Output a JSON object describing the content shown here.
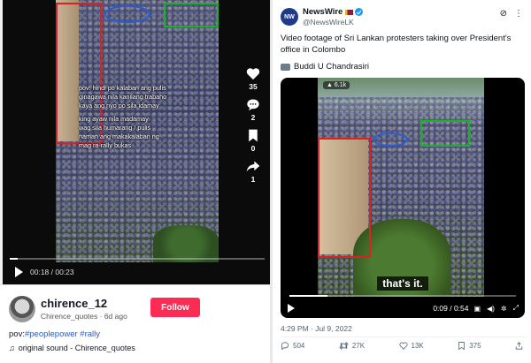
{
  "tiktok": {
    "caption_lines": [
      "pov: hindi po kalaban ang pulis",
      "ginagawa nila kanilang trabaho",
      "kaya ang nyo po sila idamay",
      "",
      "king ayaw nila madamay",
      "wag sila humarang / pulis",
      "naman ang makakalaban ng",
      "mag ra-rally bukas"
    ],
    "likes": "35",
    "comments": "2",
    "saves": "0",
    "shares": "1",
    "time": "00:18 / 00:23",
    "progress": 0.03,
    "username": "chirence_12",
    "subline": "Chirence_quotes · 6d ago",
    "follow_label": "Follow",
    "desc_prefix": "pov:",
    "hashtags": [
      "#peoplepower",
      "#rally"
    ],
    "sound": "original sound - Chirence_quotes",
    "colors": {
      "follow": "#fe2c55",
      "hashtag": "#2b5db9"
    }
  },
  "tweet": {
    "avatar_text": "NW",
    "name": "NewsWire",
    "handle": "@NewsWireLK",
    "text": "Video footage of Sri Lankan protesters taking over President's office in Colombo",
    "credit": "Buddi U Chandrasiri",
    "views": "6.1k",
    "subtitle": "that's it.",
    "time": "0:09 / 0:54",
    "progress": 0.167,
    "date": "4:29 PM · Jul 9, 2022",
    "stats": {
      "replies": "504",
      "retweets": "27K",
      "likes": "13K",
      "bookmarks": "375"
    },
    "colors": {
      "verified": "#1d9bf0",
      "handle": "#536471"
    }
  },
  "annotation_colors": {
    "red": "#e02020",
    "blue": "#2a5bd7",
    "green": "#1db02b"
  }
}
